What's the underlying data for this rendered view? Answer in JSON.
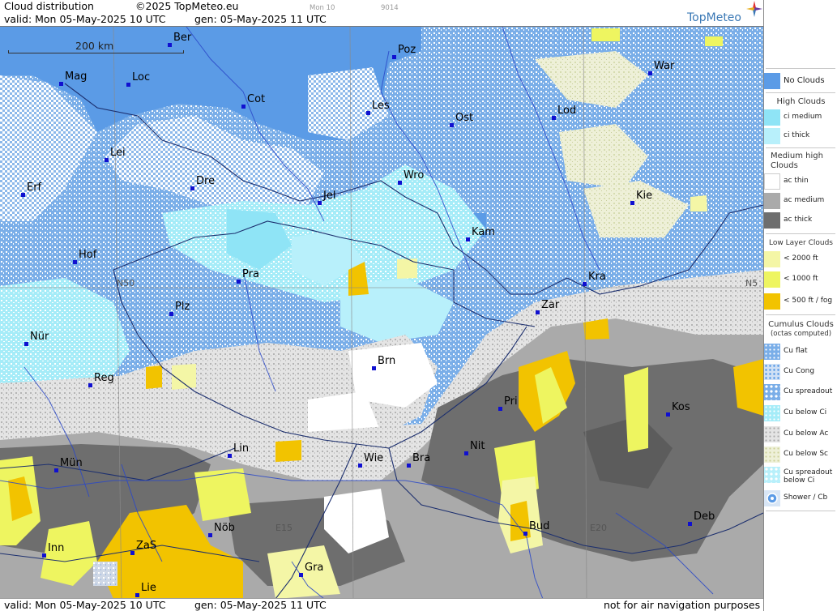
{
  "header": {
    "title": "Cloud distribution",
    "copyright": "©2025 TopMeteo.eu",
    "valid": "valid:  Mon  05-May-2025  10 UTC",
    "gen": "gen: 05-May-2025 11 UTC",
    "small_1": "Mon 10",
    "small_2": "9014",
    "brand": "TopMeteo"
  },
  "footer": {
    "valid": "valid:  Mon  05-May-2025  10 UTC",
    "gen": "gen: 05-May-2025 11 UTC",
    "disclaimer": "not for air navigation purposes"
  },
  "scale": {
    "label": "200 km"
  },
  "grid_labels": {
    "n50": "N50",
    "n50_right": "N5",
    "e15": "E15",
    "e20": "E20"
  },
  "cities": [
    {
      "name": "Ber"
    },
    {
      "name": "Poz"
    },
    {
      "name": "War"
    },
    {
      "name": "Mag"
    },
    {
      "name": "Loc"
    },
    {
      "name": "Cot"
    },
    {
      "name": "Les"
    },
    {
      "name": "Ost"
    },
    {
      "name": "Lod"
    },
    {
      "name": "Lei"
    },
    {
      "name": "Dre"
    },
    {
      "name": "Wro"
    },
    {
      "name": "Erf"
    },
    {
      "name": "Jel"
    },
    {
      "name": "Kie"
    },
    {
      "name": "Kam"
    },
    {
      "name": "Hof"
    },
    {
      "name": "Pra"
    },
    {
      "name": "Kra"
    },
    {
      "name": "Plz"
    },
    {
      "name": "Zar"
    },
    {
      "name": "Nür"
    },
    {
      "name": "Brn"
    },
    {
      "name": "Reg"
    },
    {
      "name": "Pri"
    },
    {
      "name": "Kos"
    },
    {
      "name": "Lin"
    },
    {
      "name": "Nit"
    },
    {
      "name": "Mün"
    },
    {
      "name": "Wie"
    },
    {
      "name": "Bra"
    },
    {
      "name": "Deb"
    },
    {
      "name": "Nöb"
    },
    {
      "name": "Bud"
    },
    {
      "name": "Inn"
    },
    {
      "name": "ZaS"
    },
    {
      "name": "Gra"
    },
    {
      "name": "Lie"
    }
  ],
  "legend": {
    "no_clouds": "No Clouds",
    "high_title": "High Clouds",
    "ci_medium": "ci medium",
    "ci_thick": "ci thick",
    "medium_title_1": "Medium high",
    "medium_title_2": "Clouds",
    "ac_thin": "ac thin",
    "ac_medium": "ac medium",
    "ac_thick": "ac thick",
    "low_title": "Low Layer Clouds",
    "lt2000": "< 2000 ft",
    "lt1000": "< 1000 ft",
    "lt500": "< 500 ft / fog",
    "cu_title_1": "Cumulus Clouds",
    "cu_title_2": "(octas computed)",
    "cu_flat": "Cu flat",
    "cu_cong": "Cu Cong",
    "cu_spreadout": "Cu spreadout",
    "cu_below_ci": "Cu below Ci",
    "cu_below_ac": "Cu below Ac",
    "cu_below_sc": "Cu below Sc",
    "cu_spread_ci_1": "Cu spreadout",
    "cu_spread_ci_2": "below Ci",
    "shower": "Shower / Cb"
  },
  "colors": {
    "no_clouds": "#5b9be6",
    "cu_flat_bg": "#7aaee8",
    "ci_medium": "#8fe4f6",
    "ci_thick": "#b8f0fb",
    "ac_thin": "#ffffff",
    "ac_medium": "#aaaaaa",
    "ac_thick": "#6e6e6e",
    "low_2000": "#f4f6a6",
    "low_1000": "#eef560",
    "low_500": "#f2c300",
    "cu_below_ac": "#d0d0d0",
    "cu_below_sc": "#e8ecc8",
    "city_dot": "#1010d0",
    "border": "#203070",
    "river": "#2040c0",
    "brand": "#3a78b5"
  }
}
